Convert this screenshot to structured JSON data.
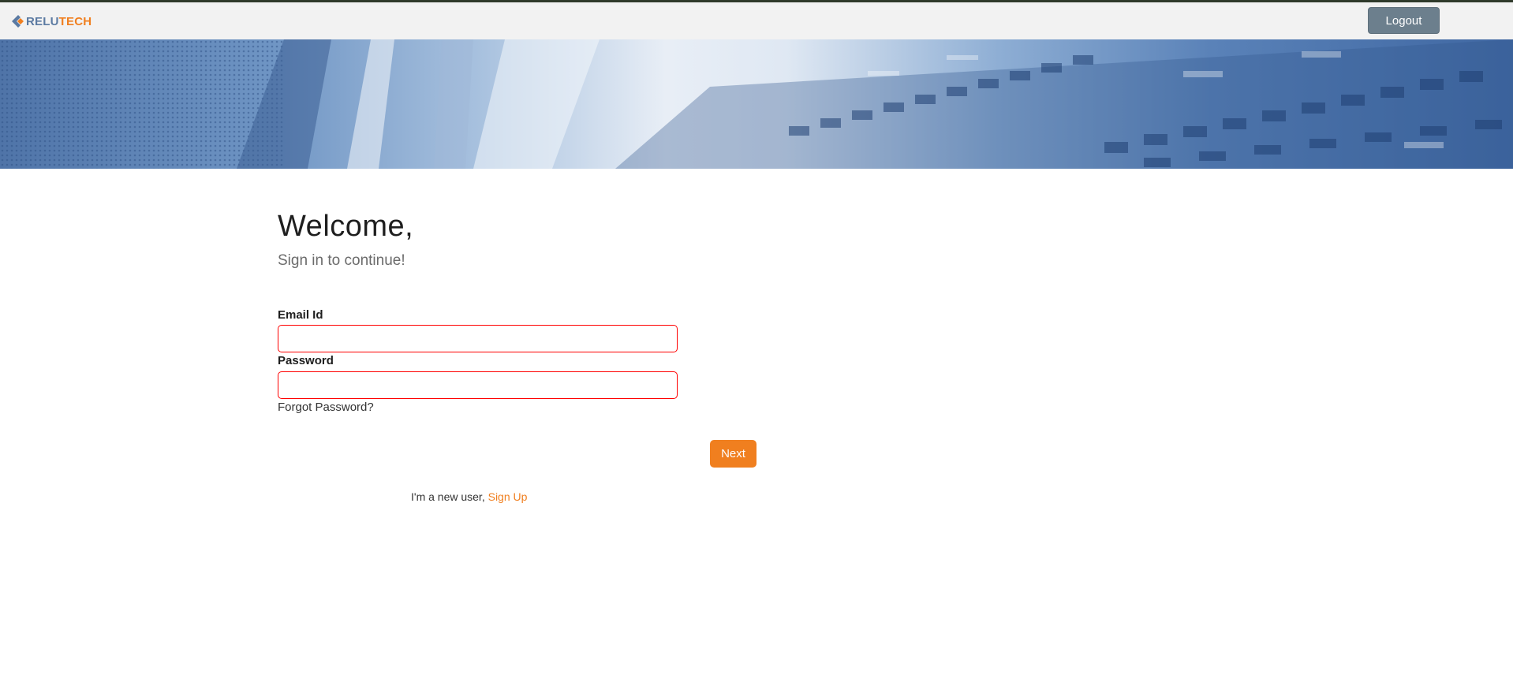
{
  "header": {
    "logo_part1": "RELU",
    "logo_part2": "TECH",
    "logout_label": "Logout"
  },
  "login": {
    "title": "Welcome,",
    "subtitle": "Sign in to continue!",
    "email_label": "Email Id",
    "email_value": "",
    "password_label": "Password",
    "password_value": "",
    "forgot_label": "Forgot Password?",
    "next_label": "Next",
    "new_user_text": "I'm a new user, ",
    "signup_label": "Sign Up"
  },
  "colors": {
    "brand_orange": "#f07f1f",
    "brand_blue": "#5b7aa2",
    "logout_bg": "#6c7f8d",
    "error_border": "#ff0000"
  },
  "icons": {
    "logo_mark": "relutech-chevron-logo"
  }
}
